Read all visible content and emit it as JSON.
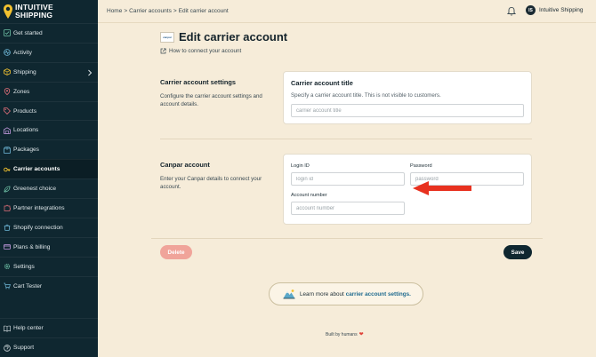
{
  "app": {
    "logo_text_line1": "INTUITIVE",
    "logo_text_line2": "SHIPPING"
  },
  "sidebar": {
    "items": [
      {
        "label": "Get started",
        "icon": "checklist-icon"
      },
      {
        "label": "Activity",
        "icon": "activity-icon"
      },
      {
        "label": "Shipping",
        "icon": "shipping-icon",
        "has_chevron": true
      },
      {
        "label": "Zones",
        "icon": "location-pin-icon"
      },
      {
        "label": "Products",
        "icon": "tag-icon"
      },
      {
        "label": "Locations",
        "icon": "warehouse-icon"
      },
      {
        "label": "Packages",
        "icon": "package-icon"
      },
      {
        "label": "Carrier accounts",
        "icon": "key-icon",
        "active": true
      },
      {
        "label": "Greenest choice",
        "icon": "leaf-icon"
      },
      {
        "label": "Partner integrations",
        "icon": "puzzle-icon"
      },
      {
        "label": "Shopify connection",
        "icon": "shopify-icon"
      },
      {
        "label": "Plans & billing",
        "icon": "credit-card-icon"
      },
      {
        "label": "Settings",
        "icon": "gear-icon"
      },
      {
        "label": "Cart Tester",
        "icon": "cart-icon"
      }
    ],
    "bottom_items": [
      {
        "label": "Help center",
        "icon": "book-icon"
      },
      {
        "label": "Support",
        "icon": "help-circle-icon"
      }
    ]
  },
  "header": {
    "breadcrumb": [
      "Home",
      ">",
      "Carrier accounts",
      ">",
      "Edit carrier account"
    ],
    "avatar_initials": "IS",
    "account_name": "Intuitive Shipping"
  },
  "page": {
    "carrier_logo_text": "canpar",
    "title": "Edit carrier account",
    "help_link": "How to connect your account"
  },
  "settings_section": {
    "heading": "Carrier account settings",
    "description": "Configure the carrier account settings and account details.",
    "card_title": "Carrier account title",
    "card_subtitle": "Specify a carrier account title. This is not visible to customers.",
    "title_input_value": "",
    "title_input_placeholder": "carrier account title"
  },
  "canpar_section": {
    "heading": "Canpar account",
    "description": "Enter your Canpar details to connect your account.",
    "login_label": "Login ID",
    "login_value": "",
    "login_placeholder": "login id",
    "password_label": "Password",
    "password_value": "",
    "password_placeholder": "password",
    "account_label": "Account number",
    "account_value": "",
    "account_placeholder": "account number"
  },
  "actions": {
    "delete_label": "Delete",
    "save_label": "Save"
  },
  "learn_more": {
    "text": "Learn more about",
    "link_text": "carrier account settings."
  },
  "footer": {
    "text": "Built by humans",
    "heart": "❤"
  },
  "colors": {
    "sidebar_bg": "#0f2730",
    "page_bg": "#f6ecd9",
    "accent_yellow": "#f2c230",
    "delete_btn": "#f0a49a",
    "save_btn": "#0f2730",
    "annotation_arrow": "#e8311f"
  }
}
